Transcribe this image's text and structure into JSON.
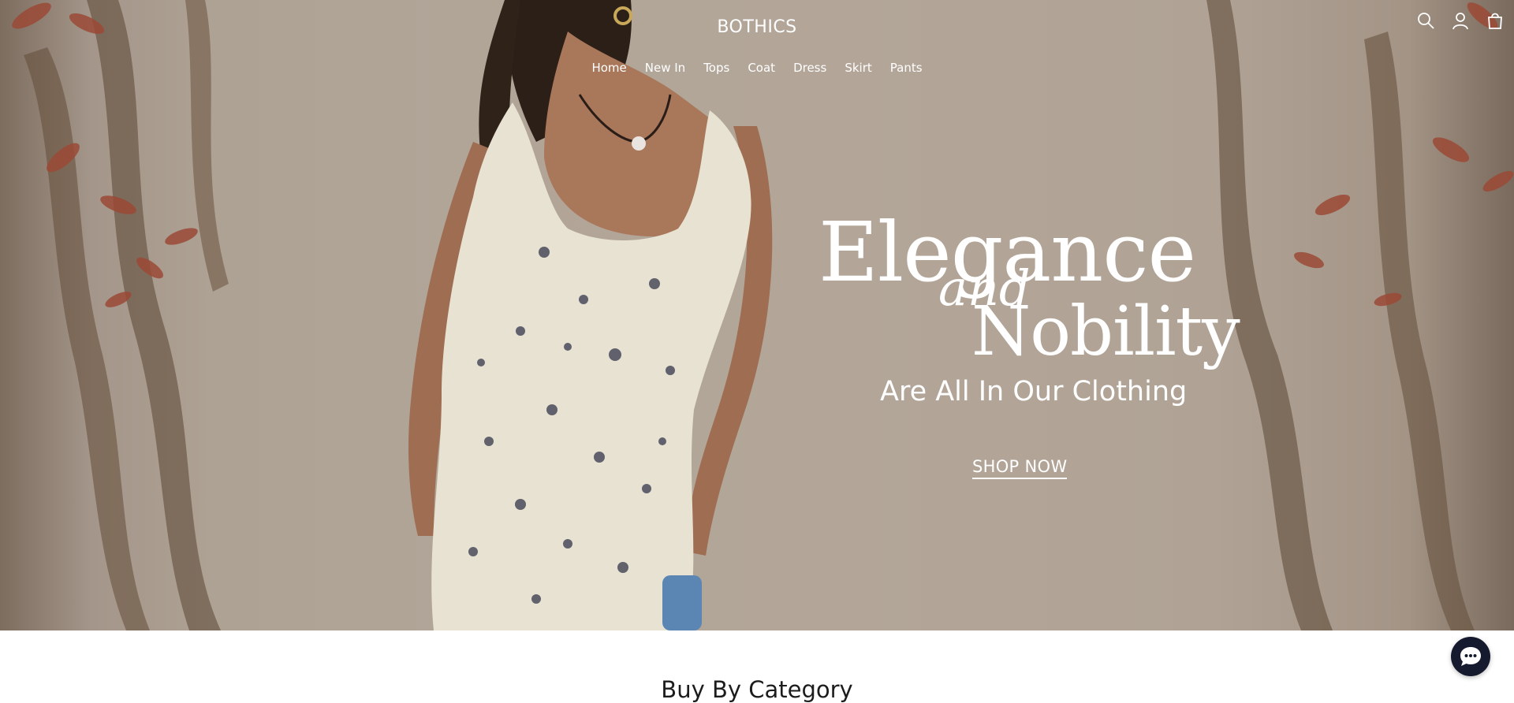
{
  "header": {
    "brand": "BOTHICS",
    "nav": [
      "Home",
      "New In",
      "Tops",
      "Coat",
      "Dress",
      "Skirt",
      "Pants"
    ],
    "icons": [
      "search-icon",
      "account-icon",
      "cart-icon"
    ]
  },
  "hero": {
    "headline_line1": "Elegance",
    "headline_connector": "and",
    "headline_line2": "Nobility",
    "tagline": "Are All In Our Clothing",
    "cta": "SHOP NOW"
  },
  "sections": {
    "category_title": "Buy By Category"
  },
  "chat": {
    "icon": "chat-bubble-icon"
  },
  "colors": {
    "hero_wall": "#b1a598",
    "dress": "#e8e2d3",
    "chat_button": "#151a2e",
    "text_on_hero": "#ffffff"
  }
}
